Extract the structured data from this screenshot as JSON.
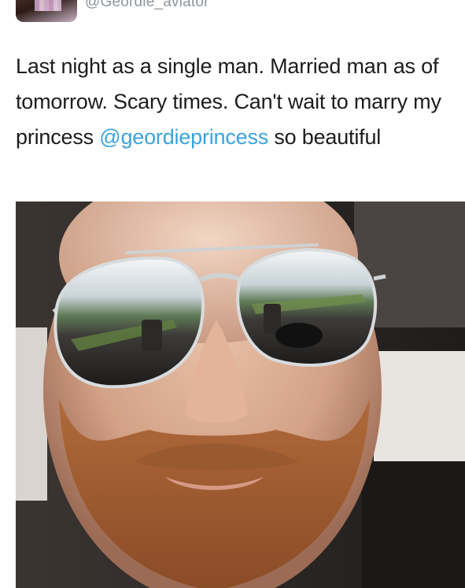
{
  "tweet": {
    "handle": "@Geordie_aviator",
    "text_parts": [
      "Last night as a single man. Married man as of tomorrow. Scary times. Can't wait to marry my princess ",
      "@geordieprincess",
      " so beautiful"
    ],
    "mention_color": "#3aa3dc"
  },
  "photo": {
    "subject": "bearded man wearing mirrored aviator sunglasses, selfie in car"
  },
  "icons": {
    "avatar": "profile-avatar"
  }
}
